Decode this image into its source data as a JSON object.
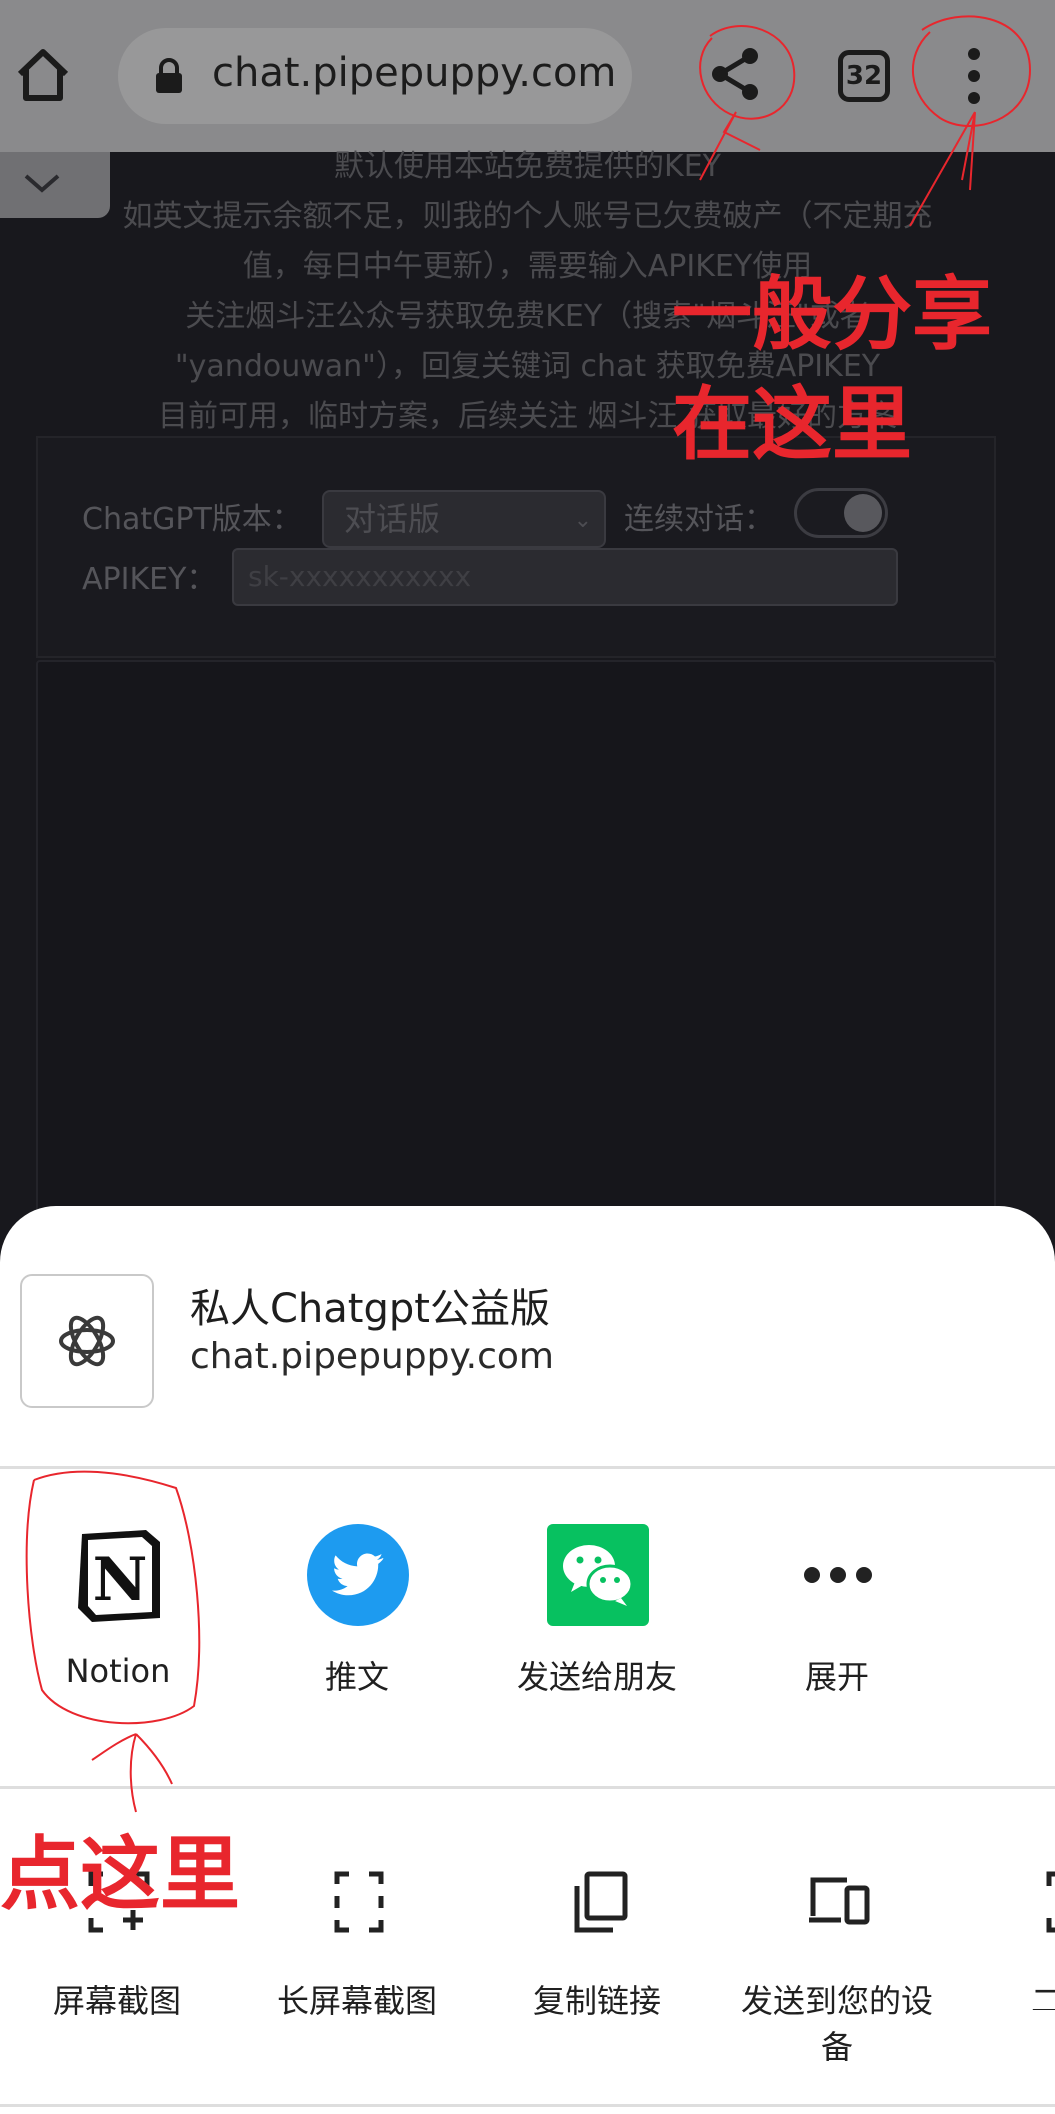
{
  "browser": {
    "url": "chat.pipepuppy.com",
    "tab_count": "32",
    "icons": [
      "home-icon",
      "lock-icon",
      "share-icon",
      "tabs-icon",
      "more-vert-icon"
    ]
  },
  "page": {
    "notice_lines": [
      "默认使用本站免费提供的KEY",
      "如英文提示余额不足，则我的个人账号已欠费破产（不定期充",
      "值，每日中午更新），需要输入APIKEY使用",
      "关注烟斗汪公众号获取免费KEY（搜索\"烟斗汪\"或者",
      "\"yandouwan\"），回复关键词 chat 获取免费APIKEY",
      "目前可用，临时方案，后续关注 烟斗汪 获取最好的方案"
    ],
    "version_label": "ChatGPT版本：",
    "version_value": "对话版",
    "continuous_label": "连续对话：",
    "continuous_on": true,
    "apikey_label": "APIKEY：",
    "apikey_placeholder": "sk-xxxxxxxxxxx"
  },
  "share_sheet": {
    "site_title": "私人Chatgpt公益版",
    "site_url": "chat.pipepuppy.com",
    "apps": [
      {
        "label": "Notion",
        "icon": "notion-icon"
      },
      {
        "label": "推文",
        "icon": "twitter-icon"
      },
      {
        "label": "发送给朋友",
        "icon": "wechat-icon"
      },
      {
        "label": "展开",
        "icon": "more-horiz-icon"
      }
    ],
    "actions": [
      {
        "label": "屏幕截图",
        "icon": "screenshot-icon"
      },
      {
        "label": "长屏幕截图",
        "icon": "long-screenshot-icon"
      },
      {
        "label": "复制链接",
        "icon": "copy-icon"
      },
      {
        "label": "发送到您的设备",
        "icon": "send-to-device-icon"
      },
      {
        "label": "二",
        "icon": "qr-code-icon"
      }
    ]
  },
  "annotations": {
    "share_hint_line1": "一般分享",
    "share_hint_line2": "在这里",
    "click_hint": "点这里",
    "color": "#e8262d"
  },
  "colors": {
    "sheet_bg": "#ffffff",
    "twitter_blue": "#1d9bf0",
    "wechat_green": "#07c160",
    "page_dim": "#18181d"
  }
}
